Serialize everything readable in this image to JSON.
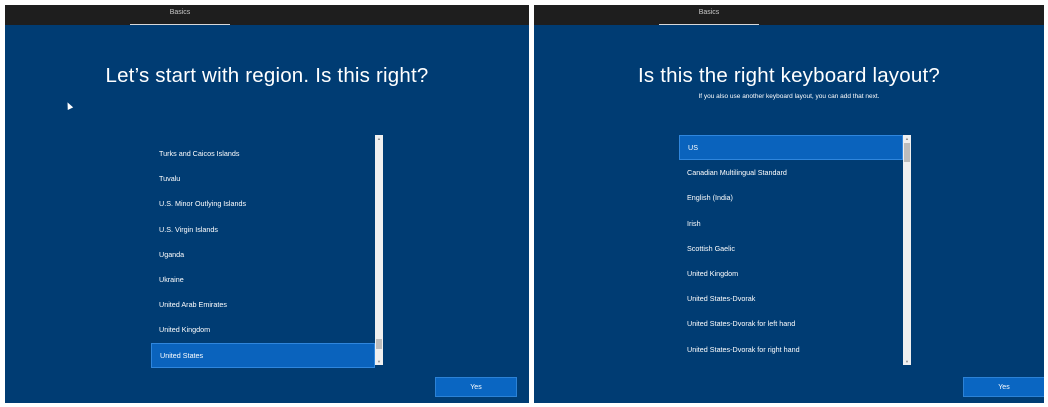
{
  "left": {
    "tab_label": "Basics",
    "headline": "Let’s start with region. Is this right?",
    "items": [
      "Turks and Caicos Islands",
      "Tuvalu",
      "U.S. Minor Outlying Islands",
      "U.S. Virgin Islands",
      "Uganda",
      "Ukraine",
      "United Arab Emirates",
      "United Kingdom",
      "United States"
    ],
    "selected_index": 8,
    "yes_label": "Yes"
  },
  "right": {
    "tab_label": "Basics",
    "headline": "Is this the right keyboard layout?",
    "subtext": "If you also use another keyboard layout, you can add that next.",
    "items": [
      "US",
      "Canadian Multilingual Standard",
      "English (India)",
      "Irish",
      "Scottish Gaelic",
      "United Kingdom",
      "United States-Dvorak",
      "United States-Dvorak for left hand",
      "United States-Dvorak for right hand"
    ],
    "selected_index": 0,
    "yes_label": "Yes"
  },
  "colors": {
    "background": "#003c73",
    "accent": "#0a63bd",
    "topbar": "#1e1e1e"
  },
  "icons": [
    "mouse-cursor-icon",
    "scroll-up-arrow-icon",
    "scroll-down-arrow-icon"
  ]
}
